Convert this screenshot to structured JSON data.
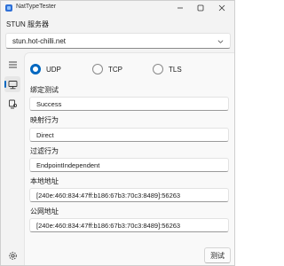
{
  "window": {
    "title": "NatTypeTester",
    "controls": [
      "minimize-icon",
      "maximize-icon",
      "close-icon"
    ]
  },
  "stun": {
    "label": "STUN 服务器",
    "server": "stun.hot-chilli.net"
  },
  "sidebar": {
    "items": [
      {
        "icon": "hamburger-menu-icon"
      },
      {
        "icon": "monitor-network-icon",
        "selected": true
      },
      {
        "icon": "desktop-user-icon"
      },
      {
        "icon": "gear-icon"
      }
    ]
  },
  "protocols": {
    "selected": "UDP",
    "options": [
      {
        "label": "UDP"
      },
      {
        "label": "TCP"
      },
      {
        "label": "TLS"
      }
    ]
  },
  "results": {
    "binding_label": "绑定测试",
    "binding_value": "Success",
    "mapping_label": "映射行为",
    "mapping_value": "Direct",
    "filtering_label": "过滤行为",
    "filtering_value": "EndpointIndependent",
    "local_label": "本地地址",
    "local_value": "[240e:460:834:47ff:b186:67b3:70c3:8489]:56263",
    "public_label": "公网地址",
    "public_value": "[240e:460:834:47ff:b186:67b3:70c3:8489]:56263"
  },
  "actions": {
    "test_label": "测试"
  },
  "colors": {
    "accent": "#0067c0",
    "window_bg": "#f3f3f3",
    "content_bg": "#f9f9f9"
  }
}
